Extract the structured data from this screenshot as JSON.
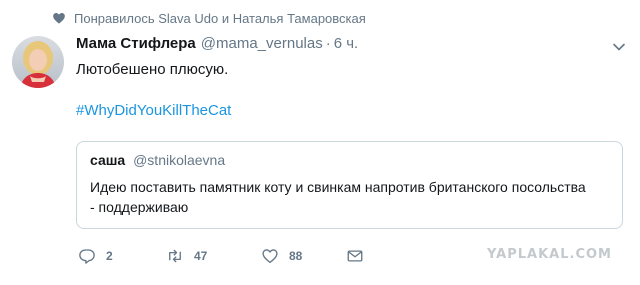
{
  "liked": {
    "text": "Понравилось Slava Udo и Наталья Тамаровская",
    "icon": "heart-icon"
  },
  "tweet": {
    "name": "Мама Стифлера",
    "handle": "@mama_vernulas",
    "separator": "·",
    "time": "6 ч.",
    "text": "Лютобешено плюсую.",
    "hashtag": "#WhyDidYouKillTheCat"
  },
  "quote": {
    "name": "саша",
    "handle": "@stnikolaevna",
    "text": "Идею поставить памятник коту и свинкам напротив британского посольства - поддерживаю"
  },
  "actions": {
    "reply_count": "2",
    "retweet_count": "47",
    "like_count": "88"
  },
  "watermark": "YAPLAKAL.COM",
  "colors": {
    "link": "#1b95e0",
    "secondary": "#657786",
    "border": "#ccd6dd"
  }
}
